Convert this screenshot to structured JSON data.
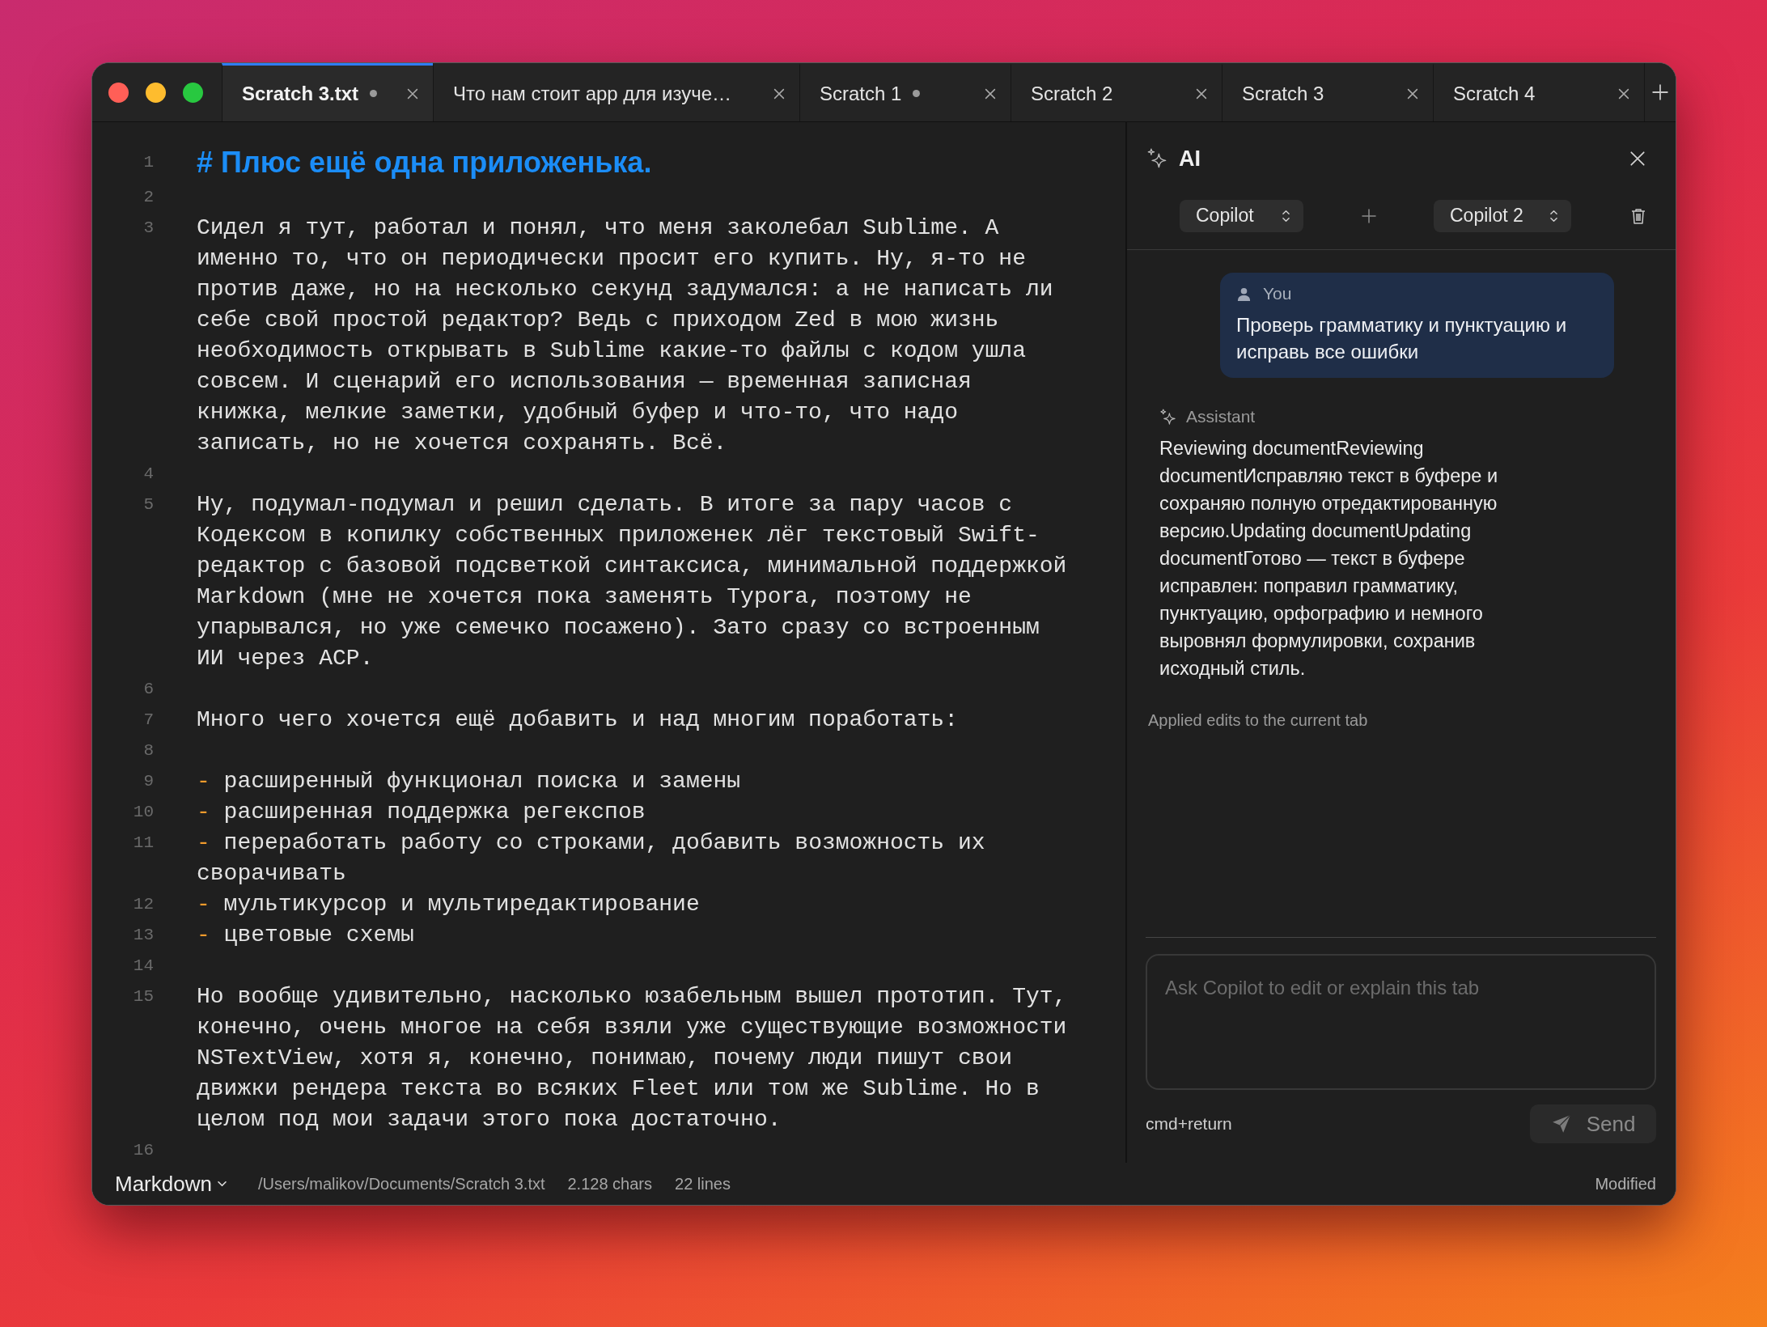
{
  "tabs": [
    {
      "label": "Scratch 3.txt",
      "modified": true,
      "selected": true
    },
    {
      "label": "Что нам стоит app для изуче…",
      "modified": false,
      "selected": false
    },
    {
      "label": "Scratch 1",
      "modified": true,
      "selected": false
    },
    {
      "label": "Scratch 2",
      "modified": false,
      "selected": false
    },
    {
      "label": "Scratch 3",
      "modified": false,
      "selected": false
    },
    {
      "label": "Scratch 4",
      "modified": false,
      "selected": false
    }
  ],
  "editor": {
    "lines": [
      {
        "number": "1",
        "kind": "heading",
        "text": "# Плюс ещё одна приложенька."
      },
      {
        "number": "2",
        "kind": "blank"
      },
      {
        "number": "3",
        "kind": "text",
        "text": "Сидел я тут, работал и понял, что меня заколебал Sublime. А именно то, что он периодически просит его купить. Ну, я-то не против даже, но на несколько секунд задумался: а не написать ли себе свой простой редактор? Ведь с приходом Zed в мою жизнь необходимость открывать в Sublime какие-то файлы с кодом ушла совсем. И сценарий его использования — временная записная книжка, мелкие заметки, удобный буфер и что-то, что надо записать, но не хочется сохранять. Всё."
      },
      {
        "number": "4",
        "kind": "blank"
      },
      {
        "number": "5",
        "kind": "text",
        "text": "Ну, подумал-подумал и решил сделать. В итоге за пару часов с Кодексом в копилку собственных приложенек лёг текстовый Swift-редактор с базовой подсветкой синтаксиса, минимальной поддержкой Markdown (мне не хочется пока заменять Typora, поэтому не упарывался, но уже семечко посажено). Зато сразу со встроенным ИИ через ACP."
      },
      {
        "number": "6",
        "kind": "blank"
      },
      {
        "number": "7",
        "kind": "text",
        "text": "Много чего хочется ещё добавить и над многим поработать:"
      },
      {
        "number": "8",
        "kind": "blank"
      },
      {
        "number": "9",
        "kind": "list",
        "marker": "-",
        "text": "расширенный функционал поиска и замены"
      },
      {
        "number": "10",
        "kind": "list",
        "marker": "-",
        "text": "расширенная поддержка регекспов"
      },
      {
        "number": "11",
        "kind": "list",
        "marker": "-",
        "text": "переработать работу со строками, добавить возможность их сворачивать"
      },
      {
        "number": "12",
        "kind": "list",
        "marker": "-",
        "text": "мультикурсор и мультиредактирование"
      },
      {
        "number": "13",
        "kind": "list",
        "marker": "-",
        "text": "цветовые схемы"
      },
      {
        "number": "14",
        "kind": "blank"
      },
      {
        "number": "15",
        "kind": "text",
        "text": "Но вообще удивительно, насколько юзабельным вышел прототип. Тут, конечно, очень многое на себя взяли уже существующие возможности NSTextView, хотя я, конечно, понимаю, почему люди пишут свои движки рендера текста во всяких Fleet или том же Sublime. Но в целом под мои задачи этого пока достаточно."
      },
      {
        "number": "16",
        "kind": "blank"
      }
    ]
  },
  "ai_panel": {
    "title": "AI",
    "agents": [
      "Copilot",
      "Copilot 2"
    ],
    "messages": [
      {
        "kind": "user",
        "author": "You",
        "text": "Проверь грамматику и пунктуацию и исправь все ошибки"
      },
      {
        "kind": "assistant",
        "author": "Assistant",
        "text": "Reviewing documentReviewing documentИсправляю текст в буфере и сохраняю полную отредактированную версию.Updating documentUpdating documentГотово — текст в буфере исправлен: поправил грамматику, пунктуацию, орфографию и немного выровнял формулировки, сохранив исходный стиль."
      }
    ],
    "status": "Applied edits to the current tab",
    "input": {
      "placeholder": "Ask Copilot to edit or explain this tab"
    },
    "shortcut": "cmd+return",
    "send_button": "Send"
  },
  "status_bar": {
    "language": "Markdown",
    "path": "/Users/malikov/Documents/Scratch 3.txt",
    "chars": "2.128 chars",
    "lines": "22 lines",
    "state": "Modified"
  }
}
